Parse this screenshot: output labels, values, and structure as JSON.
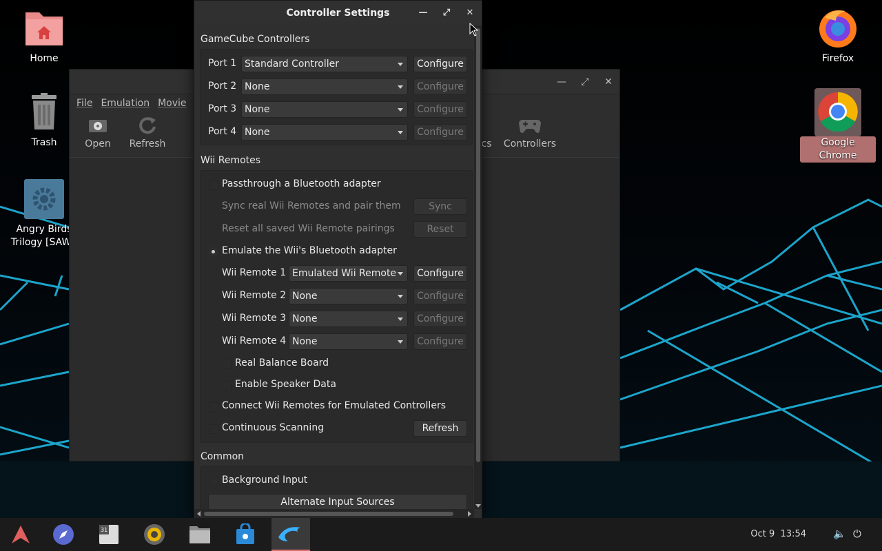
{
  "desktop": {
    "icons": [
      {
        "label": "Home"
      },
      {
        "label": "Trash"
      },
      {
        "label": "Angry Birds Trilogy [SAWE"
      },
      {
        "label": "Firefox"
      },
      {
        "label": "Google Chrome"
      }
    ]
  },
  "main_window": {
    "menu": [
      "File",
      "Emulation",
      "Movie"
    ],
    "toolbar": {
      "open": "Open",
      "refresh": "Refresh",
      "partial": "cs",
      "controllers": "Controllers"
    }
  },
  "dialog": {
    "title": "Controller Settings",
    "gamecube": {
      "title": "GameCube Controllers",
      "ports": [
        {
          "label": "Port 1",
          "value": "Standard Controller",
          "button": "Configure",
          "enabled": true
        },
        {
          "label": "Port 2",
          "value": "None",
          "button": "Configure",
          "enabled": false
        },
        {
          "label": "Port 3",
          "value": "None",
          "button": "Configure",
          "enabled": false
        },
        {
          "label": "Port 4",
          "value": "None",
          "button": "Configure",
          "enabled": false
        }
      ]
    },
    "wii": {
      "title": "Wii Remotes",
      "passthrough": "Passthrough a Bluetooth adapter",
      "sync_text": "Sync real Wii Remotes and pair them",
      "sync_button": "Sync",
      "reset_text": "Reset all saved Wii Remote pairings",
      "reset_button": "Reset",
      "emulate": "Emulate the Wii's Bluetooth adapter",
      "remotes": [
        {
          "label": "Wii Remote 1",
          "value": "Emulated Wii Remote",
          "button": "Configure",
          "enabled": true
        },
        {
          "label": "Wii Remote 2",
          "value": "None",
          "button": "Configure",
          "enabled": false
        },
        {
          "label": "Wii Remote 3",
          "value": "None",
          "button": "Configure",
          "enabled": false
        },
        {
          "label": "Wii Remote 4",
          "value": "None",
          "button": "Configure",
          "enabled": false
        }
      ],
      "balance_board": "Real Balance Board",
      "speaker": "Enable Speaker Data",
      "connect": "Connect Wii Remotes for Emulated Controllers",
      "continuous": "Continuous Scanning",
      "refresh_button": "Refresh"
    },
    "common": {
      "title": "Common",
      "background_input": "Background Input",
      "alt_sources": "Alternate Input Sources"
    }
  },
  "taskbar": {
    "date": "Oct 9",
    "time": "13:54"
  },
  "colors": {
    "dialog_bg": "#2f2f2f",
    "accent_active_app": "#e07070",
    "wallpaper_grid": "#1fb6e0"
  }
}
